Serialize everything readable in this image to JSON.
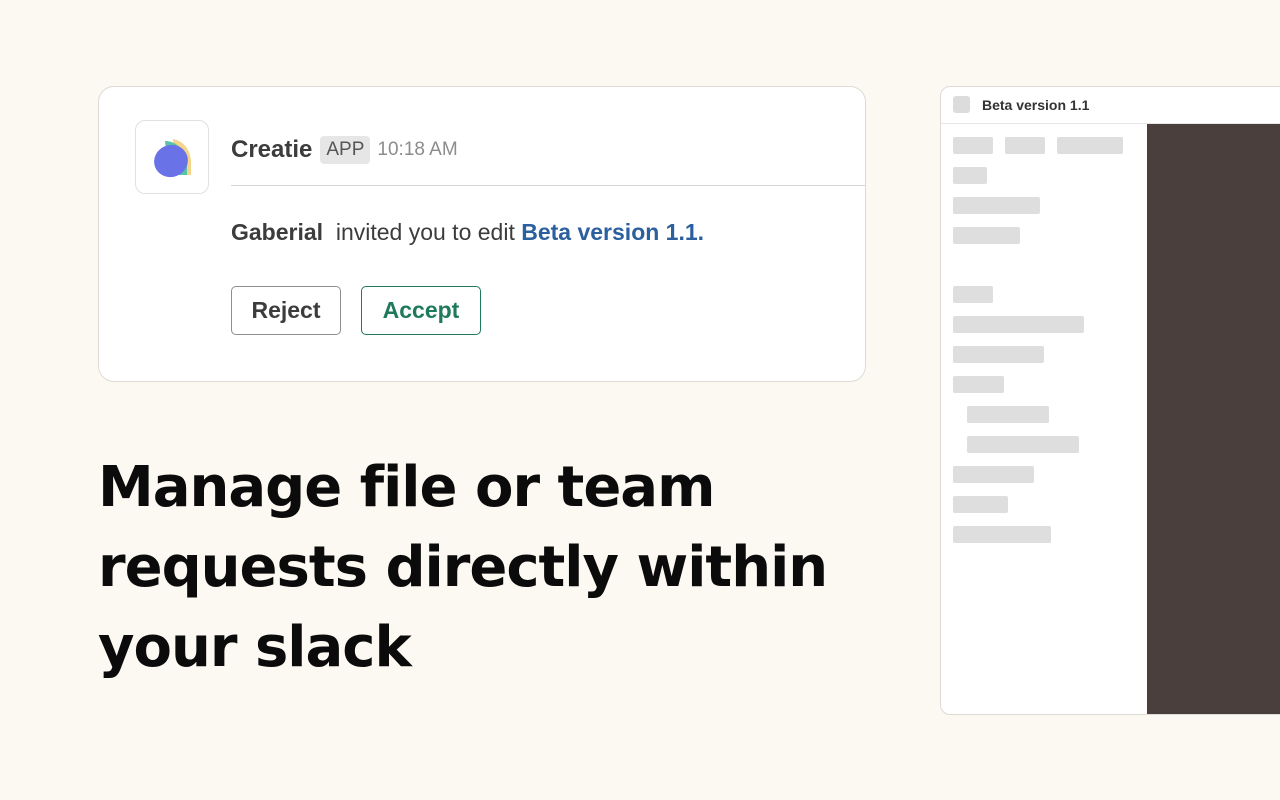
{
  "message": {
    "sender": "Creatie",
    "badge": "APP",
    "time": "10:18 AM",
    "inviter": "Gaberial",
    "action_text": "invited you to edit",
    "file_link": "Beta version 1.1.",
    "buttons": {
      "reject": "Reject",
      "accept": "Accept"
    },
    "colors": {
      "link": "#2b5f9e",
      "accept": "#1f7a5a"
    }
  },
  "headline": "Manage file or team requests directly within your slack",
  "preview": {
    "title": "Beta version 1.1",
    "canvas_color": "#4a3f3d"
  }
}
